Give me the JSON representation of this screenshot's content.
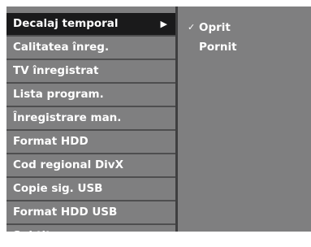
{
  "menu": {
    "items": [
      {
        "label": "Decalaj temporal",
        "selected": true
      },
      {
        "label": "Calitatea înreg."
      },
      {
        "label": "TV înregistrat"
      },
      {
        "label": "Lista program."
      },
      {
        "label": "Înregistrare man."
      },
      {
        "label": "Format HDD"
      },
      {
        "label": "Cod regional DivX"
      },
      {
        "label": "Copie sig. USB"
      },
      {
        "label": "Format HDD USB"
      },
      {
        "label": "Subtitr."
      }
    ],
    "submenu_arrow": "▶"
  },
  "submenu": {
    "options": [
      {
        "label": "Oprit",
        "checked": true,
        "check_mark": "✓"
      },
      {
        "label": "Pornit",
        "checked": false
      }
    ]
  },
  "colors": {
    "background": "#7f7f80",
    "selected": "#1a1a1b",
    "text": "#ffffff"
  }
}
